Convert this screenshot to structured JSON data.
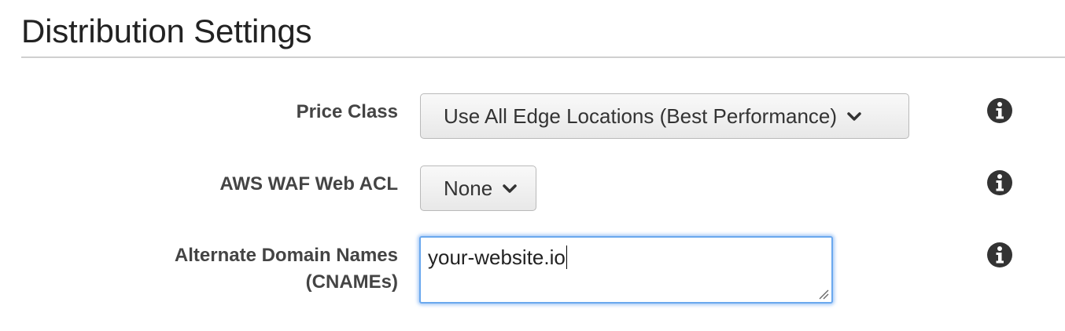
{
  "section": {
    "title": "Distribution Settings"
  },
  "fields": {
    "price_class": {
      "label": "Price Class",
      "selected": "Use All Edge Locations (Best Performance)"
    },
    "waf_acl": {
      "label": "AWS WAF Web ACL",
      "selected": "None"
    },
    "cnames": {
      "label_line1": "Alternate Domain Names",
      "label_line2": "(CNAMEs)",
      "value": "your-website.io"
    }
  },
  "icons": {
    "info": "info-icon",
    "dropdown": "chevron-down-icon",
    "resize": "resize-grip-icon"
  },
  "colors": {
    "focus_ring": "#6aa8ee",
    "info_icon": "#333333",
    "rule": "#cfcfcf"
  }
}
